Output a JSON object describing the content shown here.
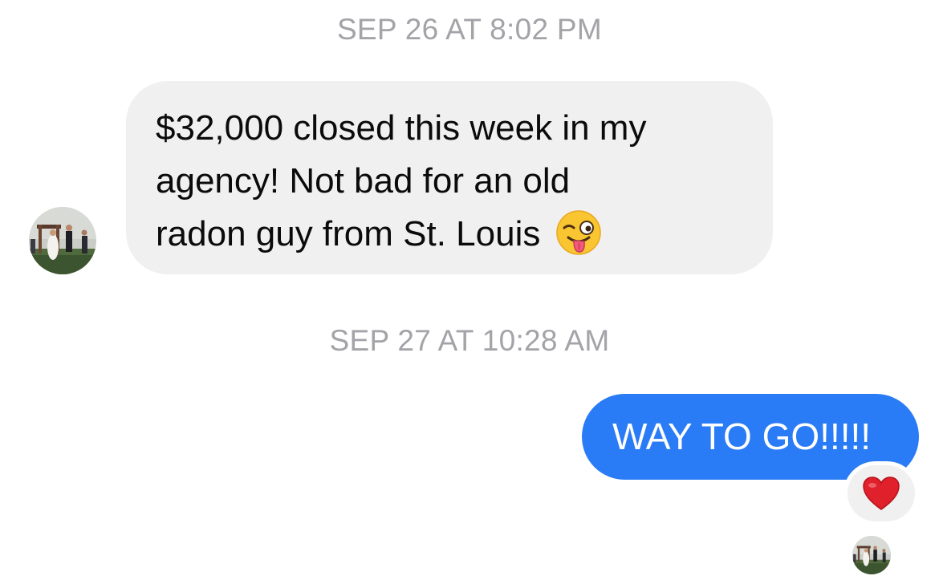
{
  "conversation": {
    "timestamps": [
      "SEP 26 AT 8:02 PM",
      "SEP 27 AT 10:28 AM"
    ],
    "incoming_message": {
      "lines": [
        "$32,000 closed this week in my",
        "agency! Not bad for an old",
        "radon guy from St. Louis"
      ],
      "emoji": "winking-face-with-tongue-icon",
      "avatar": "contact-avatar"
    },
    "outgoing_message": {
      "text": "WAY TO GO!!!!!",
      "reaction": "red-heart-icon",
      "read_receipt_avatar": "contact-avatar"
    }
  },
  "colors": {
    "background": "#ffffff",
    "timestamp": "#a3a3a8",
    "incoming_bubble": "#f0f0f0",
    "outgoing_bubble": "#2a7bf6",
    "outgoing_text": "#ffffff",
    "heart": "#e0202a"
  }
}
